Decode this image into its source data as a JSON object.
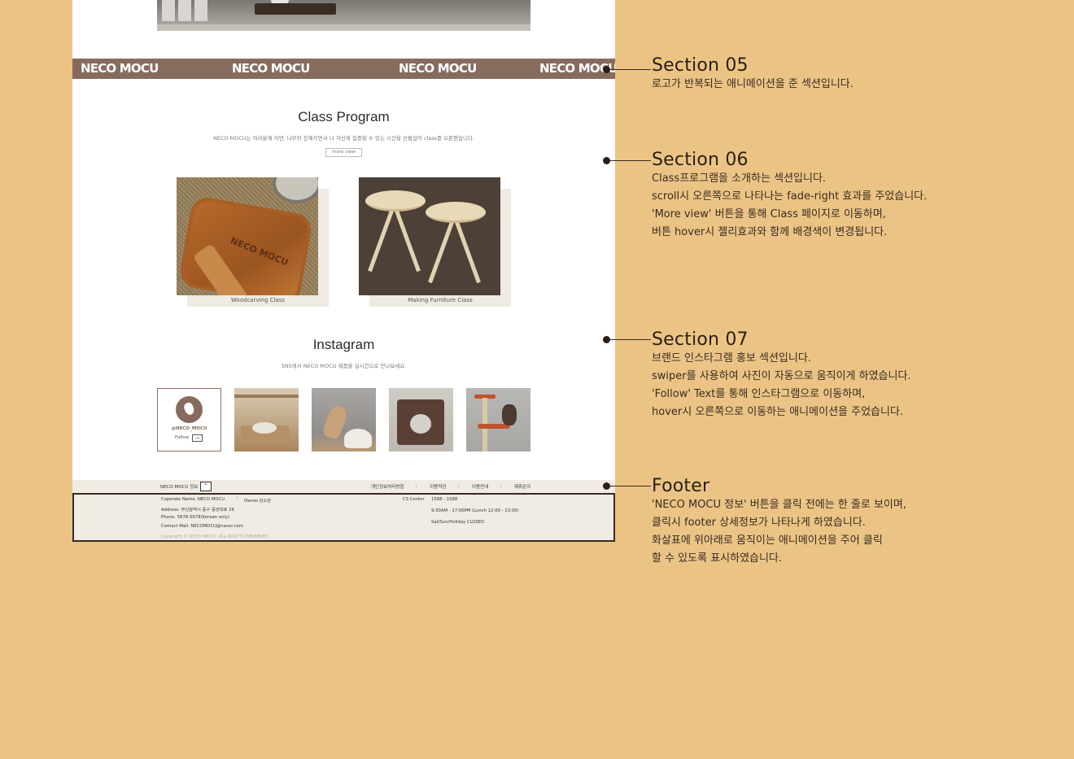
{
  "mockup": {
    "marquee_logo": "NECO MOCU",
    "class_program": {
      "title": "Class Program",
      "description": "NECO MOCU는 여러분께 자연, 나무와 친해지면서 나 자신에 집중할 수 있는 시간을 선물십어 class를 오픈했습니다.",
      "more_button": "more view",
      "cards": [
        {
          "caption": "Woodcarving Class",
          "image_text": "NECO MOCU"
        },
        {
          "caption": "Making Furniture Class"
        }
      ]
    },
    "instagram": {
      "title": "Instagram",
      "description": "SNS에서 NECO MOCU 제품을 실시간으로 만나보세요.",
      "handle": "@NECO_MOCU",
      "follow": "Follow",
      "follow_arrow": "→"
    },
    "footer": {
      "brand_toggle": "NECO MOCU 정보",
      "toggle_icon": "^",
      "links": [
        "개인정보처리방침",
        "이용약관",
        "이용안내",
        "제휴문의"
      ],
      "company": "Coperate Name. NECO MOCU",
      "owner": "Owner.강소란",
      "address": "Address. 부산광역시 중구 중앙대로 26",
      "phone": "Phone. 5678-5678(Korean only)",
      "mail": "Contact Mail. NECOMOCU@naver.com",
      "copyright": "Copyright © NECO MOCU. ALL RIGHTS RESERVED",
      "cs_label": "CS Center",
      "cs_phone": "1588 - 1588",
      "cs_hours": "9:30AM - 17:00PM (Lunch 12:00 - 13:00)",
      "cs_closed": "Sat/Sun/Holiday CLOSED"
    }
  },
  "notes": [
    {
      "title": "Section 05",
      "lines": [
        "로고가 반복되는 애니메이션을 준 섹션입니다."
      ]
    },
    {
      "title": "Section 06",
      "lines": [
        "Class프로그램을 소개하는 섹션입니다.",
        "scroll시 오른쪽으로 나타나는 fade-right 효과를 주었습니다.",
        "'More view' 버튼을 통해 Class 페이지로 이동하며,",
        "버튼 hover시 젤리효과와 함께 배경색이 변경됩니다."
      ]
    },
    {
      "title": "Section 07",
      "lines": [
        "브랜드 인스타그램 홍보 섹션입니다.",
        "swiper를 사용하여 사진이 자동으로 움직이게 하였습니다.",
        "'Follow' Text를 통해 인스타그램으로 이동하며,",
        "hover시 오른쪽으로 이동하는 애니메이션을 주었습니다."
      ]
    },
    {
      "title": "Footer",
      "lines": [
        "'NECO MOCU 정보' 버튼을 클릭 전에는 한 줄로 보이며,",
        "클릭시 footer 상세정보가 나타나게 하였습니다.",
        "화살표에 위아래로 움직이는 애니메이션을 주어 클릭",
        "할 수 있도록 표시하였습니다."
      ]
    }
  ],
  "colors": {
    "background": "#ebc485",
    "brand_brown": "#876b5f",
    "footer_bg": "#f0ece4"
  }
}
